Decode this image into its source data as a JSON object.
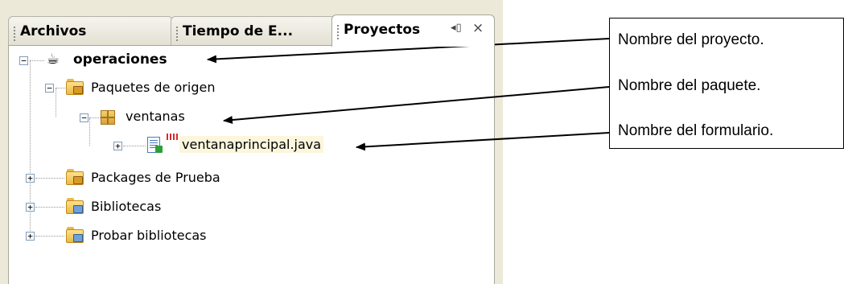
{
  "tabs": [
    {
      "label": "Archivos",
      "active": false
    },
    {
      "label": "Tiempo de E...",
      "active": false
    },
    {
      "label": "Proyectos",
      "active": true
    }
  ],
  "tab_controls": {
    "minimize_icon": "minimize-icon",
    "close_icon": "close-icon",
    "minimize_glyph": "◂▯",
    "close_glyph": "×"
  },
  "tree": {
    "project": "operaciones",
    "source_packages": "Paquetes de origen",
    "package": "ventanas",
    "form_file": "ventanaprincipal.java",
    "test_packages": "Packages de Prueba",
    "libraries": "Bibliotecas",
    "test_libraries": "Probar bibliotecas"
  },
  "callouts": [
    "Nombre del proyecto.",
    "Nombre del paquete.",
    "Nombre del formulario."
  ],
  "colors": {
    "panel_bg": "#ece9d8",
    "selection": "#fbf6dc",
    "folder": "#e9b94a"
  }
}
